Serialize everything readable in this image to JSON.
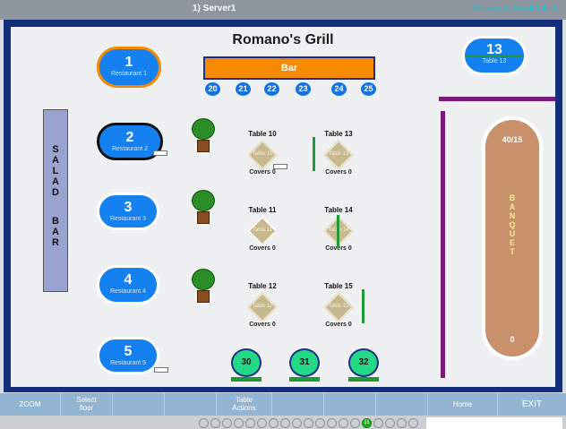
{
  "titlebar": {
    "server": "1) Server1",
    "right_info": "Restaurant Scroll Tables"
  },
  "restaurant_name": "Romano's Grill",
  "bar": {
    "label": "Bar",
    "stools": [
      "20",
      "21",
      "22",
      "23",
      "24",
      "25"
    ]
  },
  "round_tables": [
    {
      "number": "1",
      "label": "Restaurant 1"
    },
    {
      "number": "2",
      "label": "Restaurant 2"
    },
    {
      "number": "3",
      "label": "Restaurant 3"
    },
    {
      "number": "4",
      "label": "Restaurant 4"
    },
    {
      "number": "5",
      "label": "Restaurant 5"
    },
    {
      "number": "13",
      "label": "Table 13"
    }
  ],
  "salad_bar": {
    "line1": [
      "S",
      "A",
      "L",
      "A",
      "D"
    ],
    "line2": [
      "B",
      "A",
      "R"
    ]
  },
  "banquet": {
    "top": "40/15",
    "vertical": [
      "B",
      "A",
      "N",
      "Q",
      "U",
      "E",
      "T"
    ],
    "bottom": "0"
  },
  "diamond_tables": [
    {
      "title": "Table 10",
      "inner": "Table 10",
      "covers": "Covers 0"
    },
    {
      "title": "Table 13",
      "inner": "Table 13",
      "covers": "Covers 0"
    },
    {
      "title": "Table 11",
      "inner": "Table 11",
      "covers": "Covers 0"
    },
    {
      "title": "Table 14",
      "inner": "Table 14",
      "covers": "Covers 0"
    },
    {
      "title": "Table 12",
      "inner": "Table 12",
      "covers": "Covers 0"
    },
    {
      "title": "Table 15",
      "inner": "Table 15",
      "covers": "Covers 0"
    }
  ],
  "green_tables": [
    "30",
    "31",
    "32"
  ],
  "toolbar": {
    "zoom": "ZOOM",
    "select_floor_1": "Select",
    "select_floor_2": "floor",
    "table_actions_1": "Table",
    "table_actions_2": "Actions",
    "home": "Home",
    "exit": "EXIT"
  },
  "status": {
    "active_floor": "11"
  },
  "colors": {
    "frame": "#132e7a",
    "bar": "#f58a00",
    "table": "#1580f0",
    "banquet": "#c8906b",
    "green_table": "#23d986"
  }
}
